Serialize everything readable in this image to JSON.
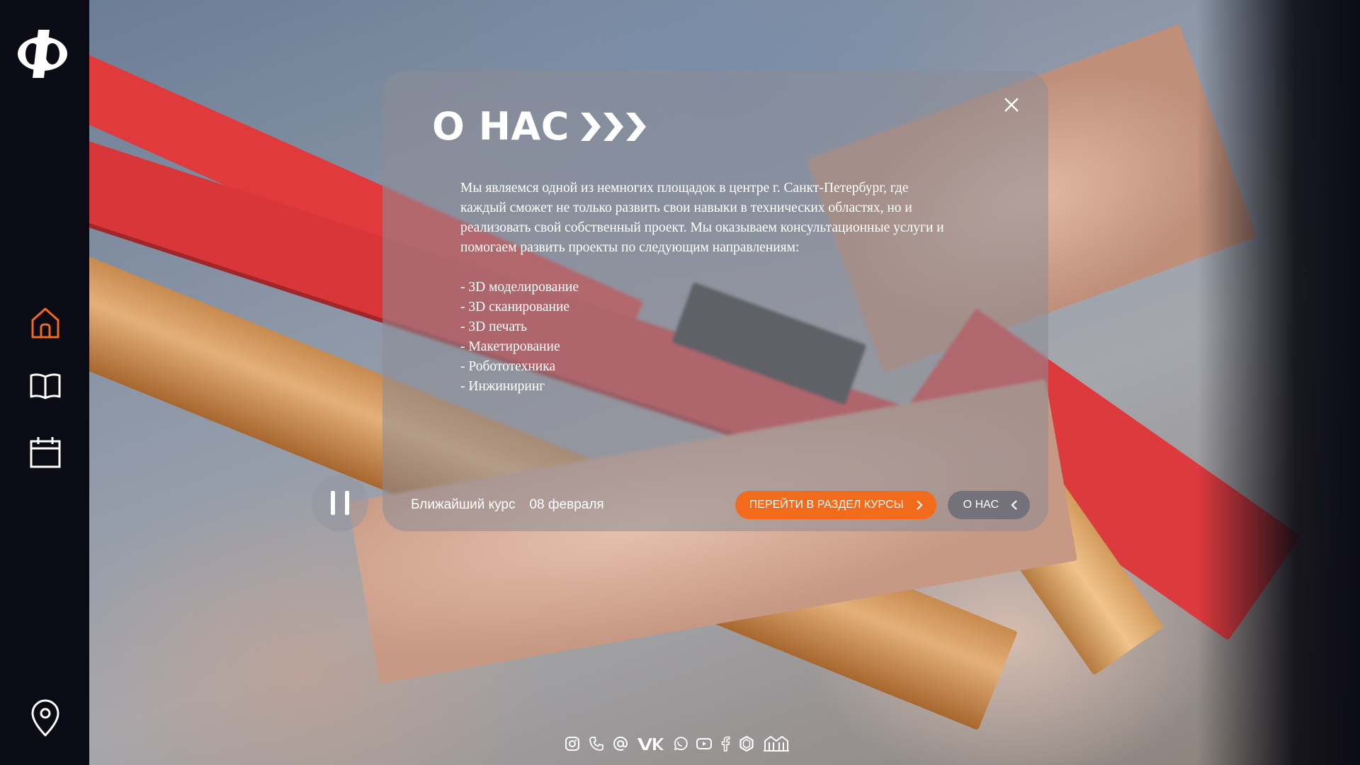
{
  "sidebar": {
    "logo_text": "Ф",
    "items": [
      {
        "icon": "home-icon",
        "active": true
      },
      {
        "icon": "book-icon",
        "active": false
      },
      {
        "icon": "calendar-icon",
        "active": false
      },
      {
        "icon": "location-pin-icon",
        "active": false
      }
    ],
    "accent_color": "#f26a1c"
  },
  "modal": {
    "title": "О НАС",
    "title_icon": "triple-chevron-right-icon",
    "intro": "Мы являемся одной из немногих площадок в центре г. Санкт-Петербург, где каждый сможет не только развить свои навыки в технических областях, но и реализовать свой собственный проект. Мы оказываем консультационные услуги и помогаем развить проекты по следующим направлениям:",
    "directions": [
      "- 3D моделирование",
      "- 3D сканирование",
      "- 3D печать",
      "- Макетирование",
      "- Робототехника",
      "- Инжиниринг"
    ],
    "close_icon": "close-icon",
    "footer": {
      "next_course_label": "Ближайший курс",
      "next_course_date": "08 февраля",
      "courses_button": "ПЕРЕЙТИ В РАЗДЕЛ КУРСЫ",
      "about_button": "О НАС"
    }
  },
  "player": {
    "pause_icon": "pause-icon"
  },
  "social": [
    "instagram-icon",
    "phone-icon",
    "email-icon",
    "vk-icon",
    "whatsapp-icon",
    "youtube-icon",
    "facebook-icon",
    "openai-icon",
    "museum-icon"
  ]
}
